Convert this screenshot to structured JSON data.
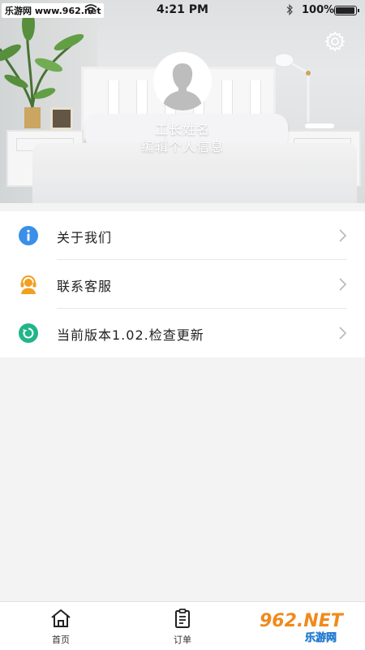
{
  "status_bar": {
    "site": "乐游网 www.962.net",
    "time": "4:21 PM",
    "battery_text": "100%",
    "battery_level": 1.0
  },
  "profile": {
    "name": "工长姓名",
    "edit_link": "编辑个人信息"
  },
  "icons": {
    "settings": "gear-icon",
    "avatar": "user-silhouette-icon",
    "about": "info-icon",
    "contact": "headset-agent-icon",
    "version": "refresh-icon",
    "chevron": "chevron-right-icon",
    "home": "home-icon",
    "orders": "clipboard-icon"
  },
  "menu": {
    "items": [
      {
        "label": "关于我们"
      },
      {
        "label": "联系客服"
      },
      {
        "label": "当前版本1.02.检查更新"
      }
    ]
  },
  "tabbar": {
    "tabs": [
      {
        "label": "首页"
      },
      {
        "label": "订单"
      }
    ]
  },
  "watermark": {
    "top": "962.NET",
    "bottom": "乐游网"
  },
  "colors": {
    "info_blue": "#3b8fe8",
    "agent_orange": "#f0a020",
    "refresh_teal": "#20b58a"
  }
}
